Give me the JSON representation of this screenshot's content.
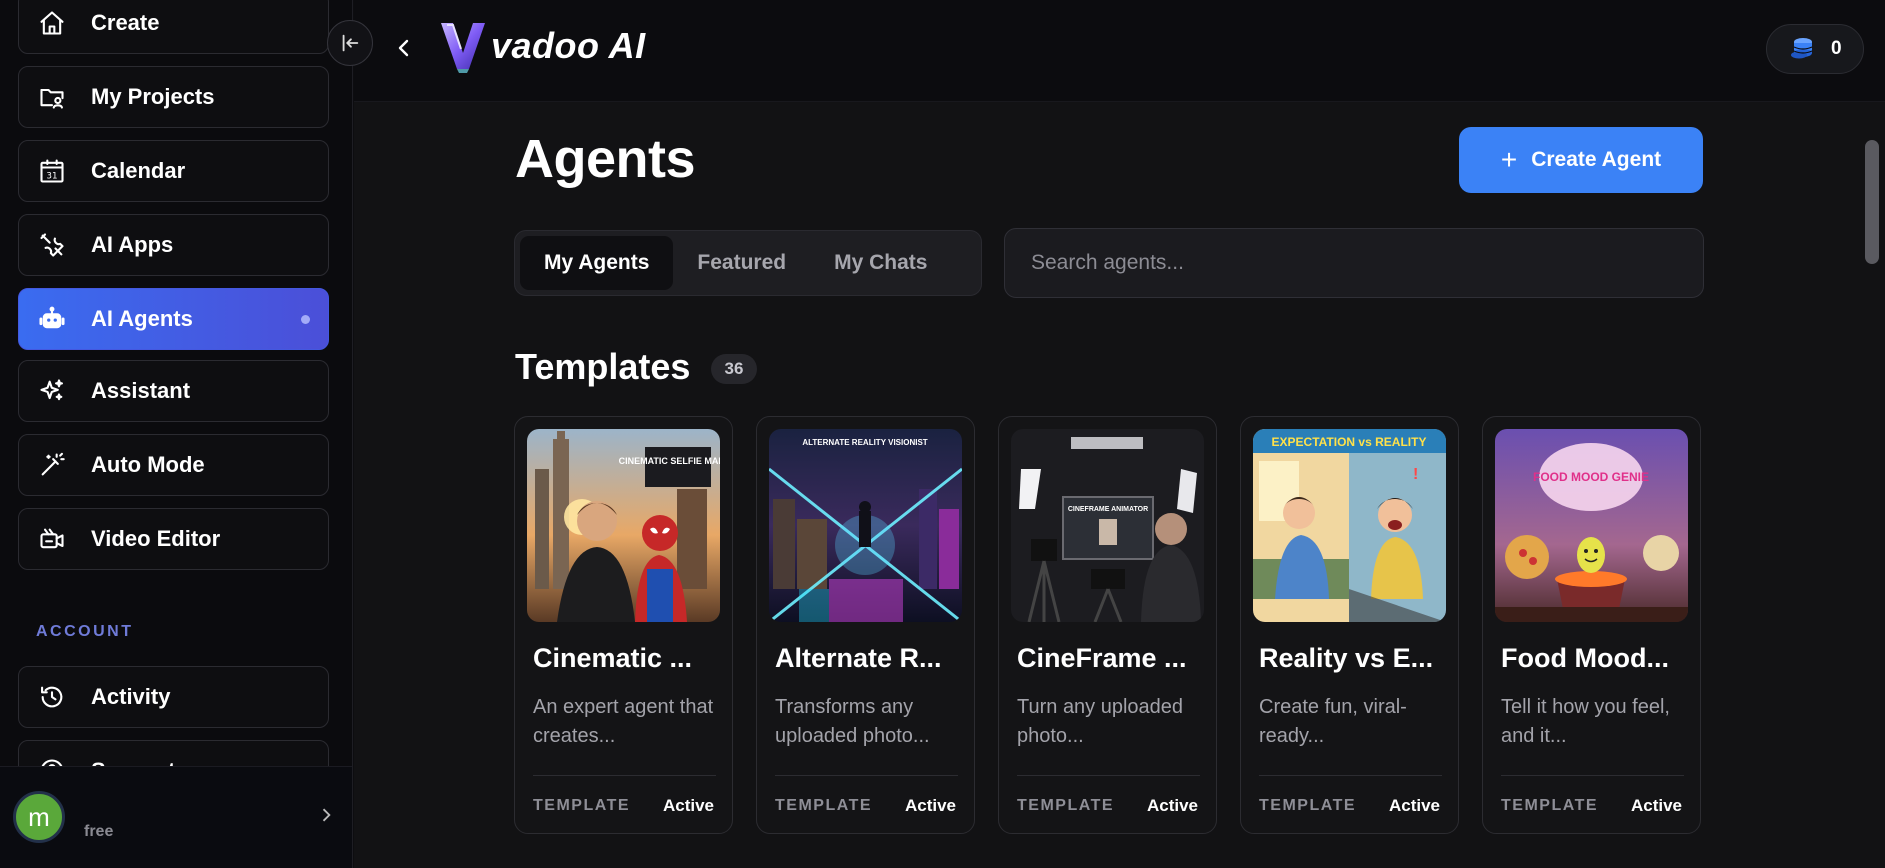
{
  "sidebar": {
    "items": [
      {
        "label": "Create",
        "icon": "home-icon"
      },
      {
        "label": "My Projects",
        "icon": "folder-user-icon"
      },
      {
        "label": "Calendar",
        "icon": "calendar-icon"
      },
      {
        "label": "AI Apps",
        "icon": "tools-icon"
      },
      {
        "label": "AI Agents",
        "icon": "robot-icon",
        "active": true
      },
      {
        "label": "Assistant",
        "icon": "sparkles-icon"
      },
      {
        "label": "Auto Mode",
        "icon": "magic-wand-icon"
      },
      {
        "label": "Video Editor",
        "icon": "video-editor-icon"
      }
    ],
    "account_label": "ACCOUNT",
    "account_items": [
      {
        "label": "Activity",
        "icon": "history-icon"
      },
      {
        "label": "Support",
        "icon": "help-icon"
      }
    ],
    "user": {
      "initial": "m",
      "plan": "free"
    }
  },
  "header": {
    "logo_text": "vadoo AI",
    "credits": "0"
  },
  "main": {
    "title": "Agents",
    "create_label": "Create Agent",
    "tabs": [
      {
        "label": "My Agents",
        "active": true
      },
      {
        "label": "Featured"
      },
      {
        "label": "My Chats"
      }
    ],
    "search_placeholder": "Search agents...",
    "templates_title": "Templates",
    "templates_count": "36",
    "cards": [
      {
        "title": "Cinematic ...",
        "desc": "An expert agent that creates...",
        "type": "TEMPLATE",
        "status": "Active",
        "thumb_text": "CINEMATIC SELFIE MAKER"
      },
      {
        "title": "Alternate R...",
        "desc": "Transforms any uploaded photo...",
        "type": "TEMPLATE",
        "status": "Active",
        "thumb_text": "ALTERNATE REALITY VISIONIST"
      },
      {
        "title": "CineFrame ...",
        "desc": "Turn any uploaded photo...",
        "type": "TEMPLATE",
        "status": "Active",
        "thumb_text": "CINEFRAME ANIMATOR"
      },
      {
        "title": "Reality vs E...",
        "desc": "Create fun, viral-ready...",
        "type": "TEMPLATE",
        "status": "Active",
        "thumb_text": "EXPECTATION vs REALITY"
      },
      {
        "title": "Food Mood...",
        "desc": "Tell it how you feel, and it...",
        "type": "TEMPLATE",
        "status": "Active",
        "thumb_text": "FOOD MOOD GENIE"
      }
    ]
  },
  "colors": {
    "accent": "#3b82f6",
    "active_nav": "#4458e0",
    "background": "#121214"
  }
}
